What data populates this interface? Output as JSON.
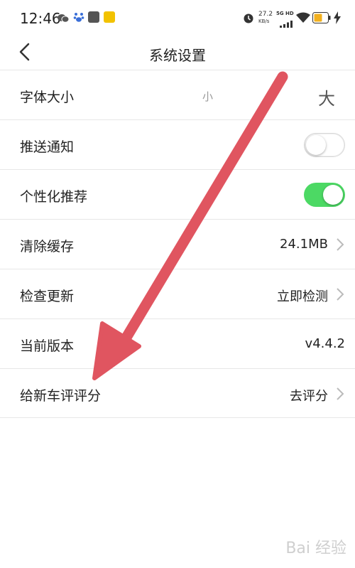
{
  "status_bar": {
    "time": "12:46",
    "speed_value": "27.2",
    "speed_unit": "KB/s",
    "network": "5G HD"
  },
  "nav": {
    "title": "系统设置"
  },
  "settings": {
    "font_size": {
      "label": "字体大小",
      "small": "小",
      "large": "大"
    },
    "push": {
      "label": "推送通知",
      "enabled": false
    },
    "personalize": {
      "label": "个性化推荐",
      "enabled": true
    },
    "cache": {
      "label": "清除缓存",
      "value": "24.1MB"
    },
    "update": {
      "label": "检查更新",
      "value": "立即检测"
    },
    "version": {
      "label": "当前版本",
      "value": "v4.4.2"
    },
    "rate": {
      "label": "给新车评评分",
      "value": "去评分"
    }
  },
  "watermark": "Bai 经验",
  "colors": {
    "toggle_on": "#4cd964",
    "arrow": "#e05560"
  }
}
